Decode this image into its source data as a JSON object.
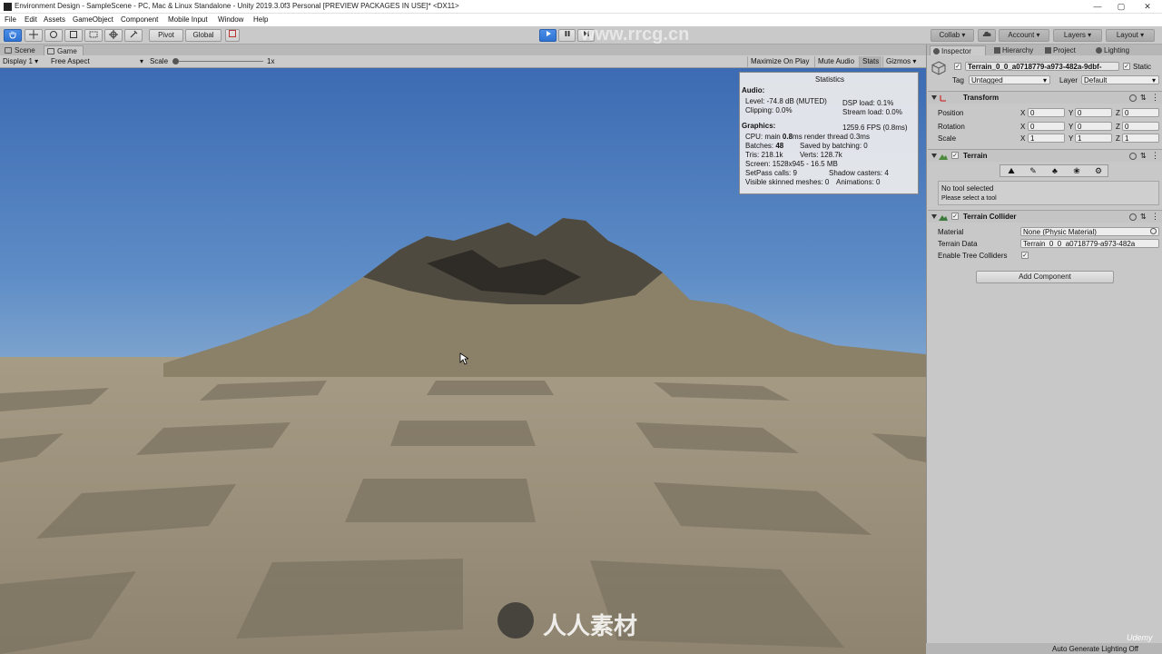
{
  "window": {
    "title": "Environment Design - SampleScene - PC, Mac & Linux Standalone - Unity 2019.3.0f3 Personal [PREVIEW PACKAGES IN USE]* <DX11>",
    "minimize": "—",
    "maximize": "▢",
    "close": "✕"
  },
  "menu": [
    "File",
    "Edit",
    "Assets",
    "GameObject",
    "Component",
    "Mobile Input",
    "Window",
    "Help"
  ],
  "toolbar": {
    "pivot": "Pivot",
    "global": "Global",
    "collab": "Collab ▾",
    "account": "Account ▾",
    "layers": "Layers ▾",
    "layout": "Layout ▾",
    "watermark_site": "www.rrcg.cn"
  },
  "view_tabs": {
    "scene": "Scene",
    "game": "Game"
  },
  "game_bar": {
    "display": "Display 1",
    "aspect": "Free Aspect",
    "scale_label": "Scale",
    "scale_value": "1x",
    "maximize_on_play": "Maximize On Play",
    "mute_audio": "Mute Audio",
    "stats": "Stats",
    "gizmos": "Gizmos"
  },
  "stats": {
    "title": "Statistics",
    "audio_header": "Audio:",
    "level": "Level: -74.8 dB (MUTED)",
    "clipping": "Clipping: 0.0%",
    "dsp_load": "DSP load: 0.1%",
    "stream_load": "Stream load: 0.0%",
    "graphics_header": "Graphics:",
    "fps": "1259.6 FPS (0.8ms)",
    "cpu_prefix": "CPU: main ",
    "cpu_main": "0.8",
    "cpu_suffix": "ms  render thread 0.3ms",
    "batches_prefix": "Batches: ",
    "batches": "48",
    "saved_by_batching": "Saved by batching: 0",
    "tris": "Tris: 218.1k",
    "verts": "Verts: 128.7k",
    "screen": "Screen: 1528x945 - 16.5 MB",
    "setpass": "SetPass calls: 9",
    "shadow_casters": "Shadow casters: 4",
    "skinned": "Visible skinned meshes: 0",
    "animations": "Animations: 0"
  },
  "inspector": {
    "tabs": [
      "Inspector",
      "Hierarchy",
      "Project",
      "Lighting"
    ],
    "object_name": "Terrain_0_0_a0718779-a973-482a-9dbf-",
    "static_label": "Static",
    "tag_label": "Tag",
    "tag_value": "Untagged",
    "layer_label": "Layer",
    "layer_value": "Default",
    "transform": {
      "title": "Transform",
      "position_label": "Position",
      "rotation_label": "Rotation",
      "scale_label": "Scale",
      "axis_x": "X",
      "axis_y": "Y",
      "axis_z": "Z",
      "position": [
        "0",
        "0",
        "0"
      ],
      "rotation": [
        "0",
        "0",
        "0"
      ],
      "scale": [
        "1",
        "1",
        "1"
      ]
    },
    "terrain": {
      "title": "Terrain",
      "no_tool": "No tool selected",
      "please_select": "Please select a tool"
    },
    "terrain_collider": {
      "title": "Terrain Collider",
      "material_label": "Material",
      "material_value": "None (Physic Material)",
      "terrain_data_label": "Terrain Data",
      "terrain_data_value": "Terrain_0_0_a0718779-a973-482a",
      "enable_tree_label": "Enable Tree Colliders"
    },
    "add_component": "Add Component"
  },
  "status": {
    "auto_lighting": "Auto Generate Lighting Off"
  },
  "overlay": {
    "brand": "人人素材",
    "udemy": "Udemy"
  },
  "colors": {
    "play_blue": "#3a7fdc",
    "sky_top": "#3c6bb3",
    "ground": "#a69c86"
  }
}
